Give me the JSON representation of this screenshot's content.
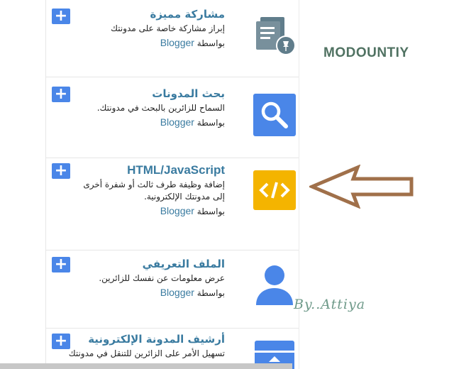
{
  "items": [
    {
      "title": "مشاركة مميزة",
      "desc_lines": [
        "إبراز مشاركة خاصة على مدونتك"
      ],
      "by_label": "بواسطة",
      "owner": "Blogger",
      "add_symbol": "+",
      "icon": "featured-post-icon"
    },
    {
      "title": "بحث المدونات",
      "desc_lines": [
        "السماح للزائرين بالبحث في مدونتك."
      ],
      "by_label": "بواسطة",
      "owner": "Blogger",
      "add_symbol": "+",
      "icon": "search-icon"
    },
    {
      "title": "HTML/JavaScript",
      "desc_lines": [
        "إضافة وظيفة طرف ثالث أو شفرة أخرى",
        "إلى مدونتك الإلكترونية."
      ],
      "by_label": "بواسطة",
      "owner": "Blogger",
      "add_symbol": "+",
      "icon": "code-icon"
    },
    {
      "title": "الملف التعريفي",
      "desc_lines": [
        "عرض معلومات عن نفسك للزائرين."
      ],
      "by_label": "بواسطة",
      "owner": "Blogger",
      "add_symbol": "+",
      "icon": "profile-icon"
    },
    {
      "title": "أرشيف المدونة الإلكترونية",
      "desc_lines": [
        "تسهيل الأمر على الزائرين للتنقل في مدونتك"
      ],
      "add_symbol": "+",
      "icon": "archive-icon"
    }
  ],
  "brand": "MODOUNTIY",
  "signature": "By..Attiya",
  "colors": {
    "accent": "#4a86e8",
    "title": "#3a7ba0",
    "code_icon_bg": "#f4b400",
    "arrow": "#a0704a",
    "brand": "#507262"
  }
}
